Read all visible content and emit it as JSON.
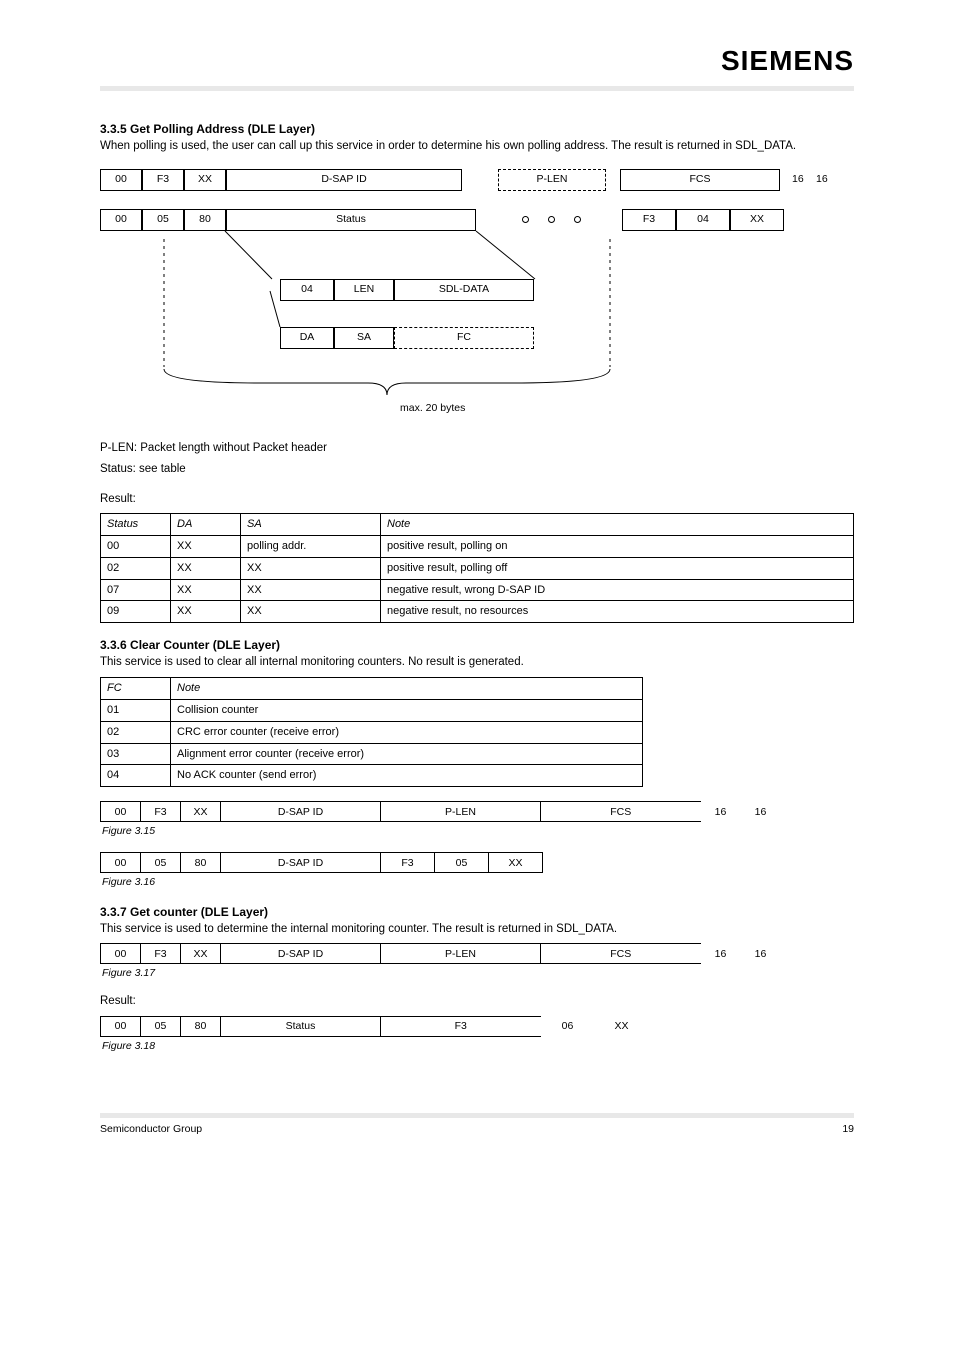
{
  "brand": "SIEMENS",
  "section35_title": "3.3.5 Get Polling Address (DLE Layer)",
  "section35_text": "When polling is used, the user can call up this service in order to determine his own polling address. The result is returned in SDL_DATA.",
  "diagram": {
    "row1": {
      "a": "00",
      "b": "F3",
      "c": "XX",
      "d": "D-SAP ID",
      "e": "P-LEN",
      "f": "FCS",
      "g": "16",
      "h": "16"
    },
    "row2": {
      "a": "00",
      "b": "05",
      "c": "80",
      "d": "Status",
      "e": "F3",
      "f": "04",
      "g": "XX"
    },
    "sub1": {
      "a": "04",
      "b": "LEN",
      "c": "SDL-DATA"
    },
    "sub2": {
      "a": "DA",
      "b": "SA",
      "c": "FC"
    },
    "p_len_note": "P-LEN: Packet length without Packet header",
    "status_note": "Status: see table",
    "braces": "max. 20 bytes"
  },
  "res_label": "Result:",
  "table1_headers": {
    "c1": "Status",
    "c2": "DA",
    "c3": "SA",
    "c4": "Note"
  },
  "table1_rows": [
    {
      "c1": "00",
      "c2": "XX",
      "c3": "polling addr.",
      "c4": "positive result, polling on"
    },
    {
      "c1": "02",
      "c2": "XX",
      "c3": "XX",
      "c4": "positive result, polling off"
    },
    {
      "c1": "07",
      "c2": "XX",
      "c3": "XX",
      "c4": "negative result, wrong D-SAP ID"
    },
    {
      "c1": "09",
      "c2": "XX",
      "c3": "XX",
      "c4": "negative result, no resources"
    }
  ],
  "section36_title": "3.3.6 Clear Counter (DLE Layer)",
  "section36_text": "This service is used to clear all internal monitoring counters. No result is generated.",
  "table2_headers": {
    "c1": "FC",
    "c2": "Note"
  },
  "table2_rows": [
    {
      "c1": "01",
      "c2": "Collision counter"
    },
    {
      "c1": "02",
      "c2": "CRC error counter (receive error)"
    },
    {
      "c1": "03",
      "c2": "Alignment error counter (receive error)"
    },
    {
      "c1": "04",
      "c2": "No ACK counter (send error)"
    }
  ],
  "rd1": {
    "a": "00",
    "b": "F3",
    "c": "XX",
    "d": "D-SAP ID",
    "e": "P-LEN",
    "f": "FCS",
    "g": "16",
    "h": "16"
  },
  "rd1_caption": "Figure 3.15",
  "rd2": {
    "a": "00",
    "b": "05",
    "c": "80",
    "d": "D-SAP ID",
    "e": "F3",
    "f": "05",
    "g": "XX"
  },
  "rd2_caption": "Figure 3.16",
  "rd3": {
    "a": "00",
    "b": "F3",
    "c": "XX",
    "d": "D-SAP ID",
    "e": "P-LEN",
    "f": "FCS",
    "g": "16",
    "h": "16"
  },
  "rd3_caption": "Figure 3.17",
  "rd4": {
    "a": "00",
    "b": "05",
    "c": "80",
    "d": "Status",
    "e": "F3",
    "f": "06",
    "g": "XX"
  },
  "rd4_caption": "Figure 3.18",
  "section37_title": "3.3.7 Get counter (DLE Layer)",
  "section37_text": "This service is used to determine the internal monitoring counter. The result is returned in SDL_DATA.",
  "res2_label": "Result:",
  "footer_left": "Semiconductor Group",
  "footer_right": "19"
}
